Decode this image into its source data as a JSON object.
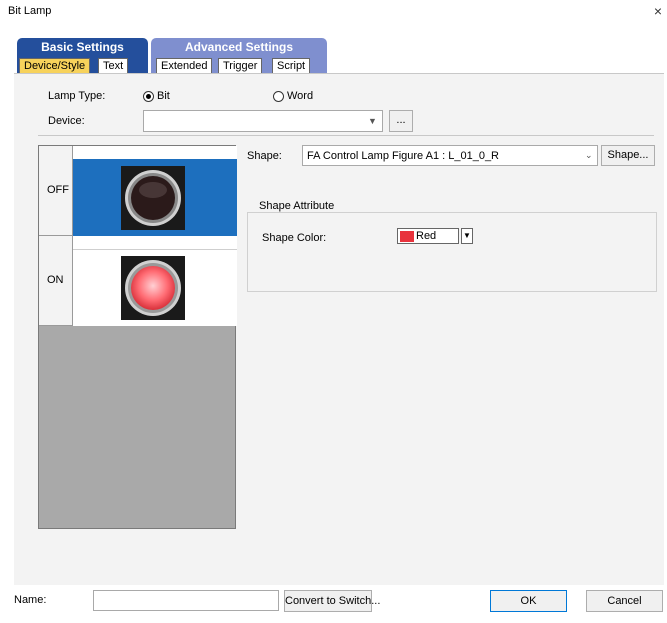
{
  "window": {
    "title": "Bit Lamp",
    "close_glyph": "×"
  },
  "tabs": {
    "basic": {
      "label": "Basic Settings",
      "subtabs": [
        "Device/Style",
        "Text"
      ]
    },
    "advanced": {
      "label": "Advanced Settings",
      "subtabs": [
        "Extended",
        "Trigger",
        "Script"
      ]
    }
  },
  "lamp_type": {
    "label": "Lamp Type:",
    "options": [
      "Bit",
      "Word"
    ],
    "selected": "Bit"
  },
  "device": {
    "label": "Device:",
    "value": "",
    "browse_label": "..."
  },
  "states": [
    {
      "label": "OFF",
      "lamp_color": "#3a2a2a",
      "selected": true
    },
    {
      "label": "ON",
      "lamp_color": "#ff6b73",
      "selected": false
    }
  ],
  "shape": {
    "label": "Shape:",
    "value": "FA Control Lamp Figure A1 : L_01_0_R",
    "button_label": "Shape..."
  },
  "shape_attribute": {
    "title": "Shape Attribute",
    "color_label": "Shape Color:",
    "color_value": "Red",
    "color_swatch": "#e8323c"
  },
  "footer": {
    "name_label": "Name:",
    "name_value": "",
    "convert_label": "Convert to Switch...",
    "ok_label": "OK",
    "cancel_label": "Cancel"
  },
  "colors": {
    "basic_tab": "#244f9c",
    "advanced_tab": "#7f8fcf",
    "active_subtab": "#f7d25b",
    "selection_blue": "#1d6fbe"
  }
}
